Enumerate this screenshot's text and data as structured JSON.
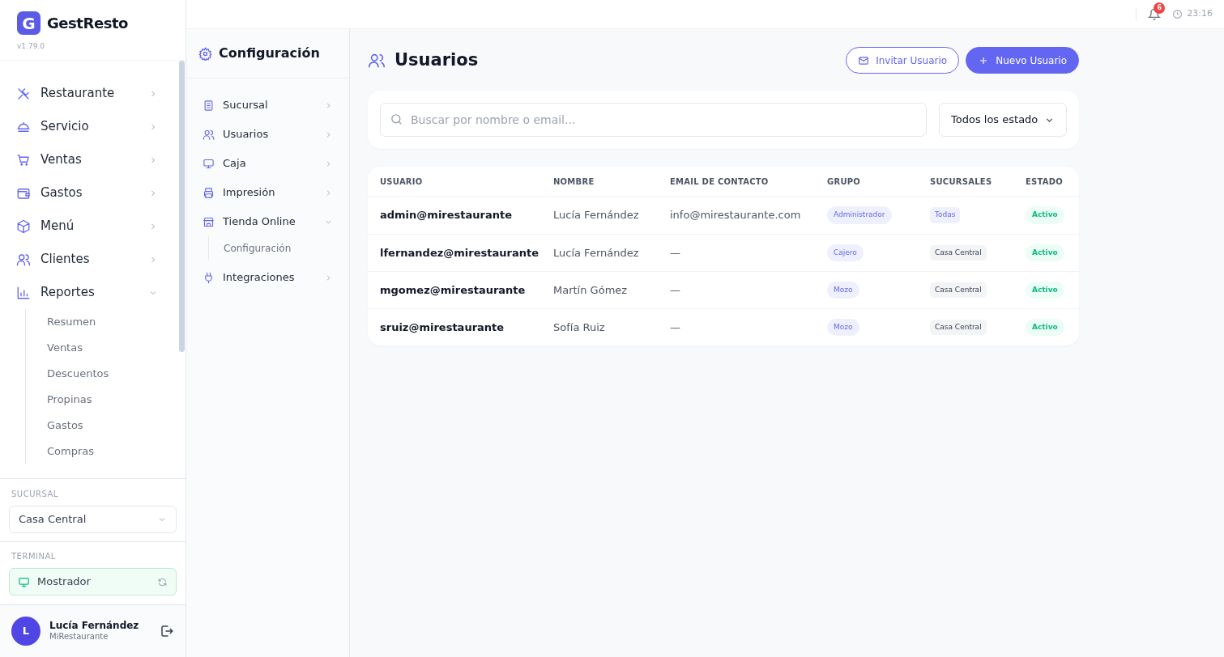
{
  "sidebar": {
    "logo_letter": "G",
    "brand": "GestResto",
    "version": "v1.79.0",
    "items": [
      {
        "label": "Restaurante",
        "expanded": false
      },
      {
        "label": "Servicio",
        "expanded": false
      },
      {
        "label": "Ventas",
        "expanded": false
      },
      {
        "label": "Gastos",
        "expanded": false
      },
      {
        "label": "Menú",
        "expanded": false
      },
      {
        "label": "Clientes",
        "expanded": false
      },
      {
        "label": "Reportes",
        "expanded": true,
        "children": [
          {
            "label": "Resumen"
          },
          {
            "label": "Ventas"
          },
          {
            "label": "Descuentos"
          },
          {
            "label": "Propinas"
          },
          {
            "label": "Gastos"
          },
          {
            "label": "Compras"
          }
        ]
      }
    ],
    "branch": {
      "label": "SUCURSAL",
      "value": "Casa Central"
    },
    "terminal": {
      "label": "TERMINAL",
      "value": "Mostrador"
    },
    "user": {
      "initial": "L",
      "name": "Lucía Fernández",
      "organization": "MiRestaurante"
    }
  },
  "header": {
    "notification_count": "6",
    "time": "23:16"
  },
  "config_panel": {
    "title": "Configuración",
    "items": [
      {
        "label": "Sucursal",
        "expanded": false
      },
      {
        "label": "Usuarios",
        "expanded": false
      },
      {
        "label": "Caja",
        "expanded": false
      },
      {
        "label": "Impresión",
        "expanded": false
      },
      {
        "label": "Tienda Online",
        "expanded": true,
        "children": [
          {
            "label": "Configuración"
          }
        ]
      },
      {
        "label": "Integraciones",
        "expanded": false
      }
    ]
  },
  "main": {
    "title": "Usuarios",
    "buttons": [
      {
        "label": "Invitar Usuario",
        "kind": "outline"
      },
      {
        "label": "Nuevo Usuario",
        "kind": "primary"
      }
    ],
    "search": {
      "placeholder": "Buscar por nombre o email..."
    },
    "status_filter": {
      "value": "Todos los estado"
    },
    "table": {
      "columns": [
        "USUARIO",
        "NOMBRE",
        "EMAIL DE CONTACTO",
        "GRUPO",
        "SUCURSALES",
        "ESTADO"
      ],
      "rows": [
        {
          "usuario": "admin@mirestaurante",
          "nombre": "Lucía Fernández",
          "email": "info@mirestaurante.com",
          "grupo": "Administrador",
          "sucursales": {
            "label": "Todas",
            "kind": "all"
          },
          "estado": {
            "label": "Activo",
            "kind": "active"
          }
        },
        {
          "usuario": "lfernandez@mirestaurante",
          "nombre": "Lucía Fernández",
          "email": "—",
          "grupo": "Cajero",
          "sucursales": {
            "label": "Casa Central",
            "kind": "branch"
          },
          "estado": {
            "label": "Activo",
            "kind": "active"
          }
        },
        {
          "usuario": "mgomez@mirestaurante",
          "nombre": "Martín Gómez",
          "email": "—",
          "grupo": "Mozo",
          "sucursales": {
            "label": "Casa Central",
            "kind": "branch"
          },
          "estado": {
            "label": "Activo",
            "kind": "active"
          }
        },
        {
          "usuario": "sruiz@mirestaurante",
          "nombre": "Sofía Ruiz",
          "email": "—",
          "grupo": "Mozo",
          "sucursales": {
            "label": "Casa Central",
            "kind": "branch"
          },
          "estado": {
            "label": "Activo",
            "kind": "active"
          }
        }
      ]
    }
  }
}
